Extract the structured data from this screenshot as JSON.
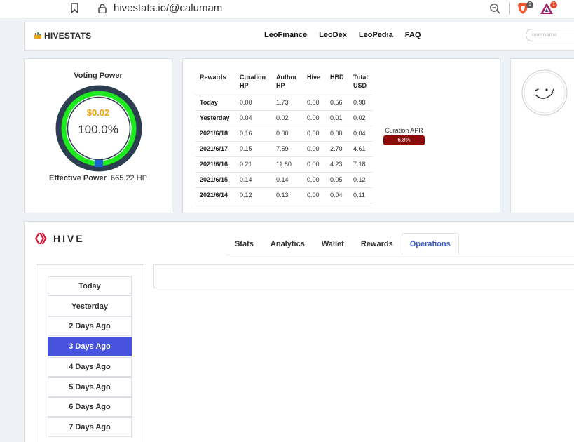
{
  "browser": {
    "url": "hivestats.io/@calumam",
    "brave_badge": "1",
    "rewards_badge": "1"
  },
  "header": {
    "logo": "HIVESTATS",
    "nav": [
      "LeoFinance",
      "LeoDex",
      "LeoPedia",
      "FAQ"
    ],
    "search_placeholder": "username"
  },
  "voting": {
    "title": "Voting Power",
    "usd_value": "$0.02",
    "percent_text": "100.0%",
    "percent": 100,
    "effective_label": "Effective Power",
    "effective_value": "665.22 HP"
  },
  "rewards": {
    "headers": [
      "Rewards",
      "Curation HP",
      "Author HP",
      "Hive",
      "HBD",
      "Total USD"
    ],
    "rows": [
      [
        "Today",
        "0.00",
        "1.73",
        "0.00",
        "0.56",
        "0.98"
      ],
      [
        "Yesterday",
        "0.04",
        "0.02",
        "0.00",
        "0.01",
        "0.02"
      ],
      [
        "2021/6/18",
        "0.16",
        "0.00",
        "0.00",
        "0.00",
        "0.04"
      ],
      [
        "2021/6/17",
        "0.15",
        "7.59",
        "0.00",
        "2.70",
        "4.61"
      ],
      [
        "2021/6/16",
        "0.21",
        "11.80",
        "0.00",
        "4.23",
        "7.18"
      ],
      [
        "2021/6/15",
        "0.14",
        "0.14",
        "0.00",
        "0.05",
        "0.12"
      ],
      [
        "2021/6/14",
        "0.12",
        "0.13",
        "0.00",
        "0.04",
        "0.11"
      ]
    ],
    "apr_label": "Curation APR",
    "apr_value": "6.8%"
  },
  "hive": {
    "logo_text": "HIVE",
    "tabs": [
      {
        "label": "Stats",
        "active": false
      },
      {
        "label": "Analytics",
        "active": false
      },
      {
        "label": "Wallet",
        "active": false
      },
      {
        "label": "Rewards",
        "active": false
      },
      {
        "label": "Operations",
        "active": true
      }
    ],
    "days": [
      {
        "label": "Today",
        "active": false
      },
      {
        "label": "Yesterday",
        "active": false
      },
      {
        "label": "2 Days Ago",
        "active": false
      },
      {
        "label": "3 Days Ago",
        "active": true
      },
      {
        "label": "4 Days Ago",
        "active": false
      },
      {
        "label": "5 Days Ago",
        "active": false
      },
      {
        "label": "6 Days Ago",
        "active": false
      },
      {
        "label": "7 Days Ago",
        "active": false
      }
    ]
  },
  "colors": {
    "accent": "#4753de",
    "gauge_ring": "#2c3e50",
    "gauge_fill": "#1ee81e",
    "usd": "#f0a30a",
    "apr_badge": "#8b0b0b"
  }
}
